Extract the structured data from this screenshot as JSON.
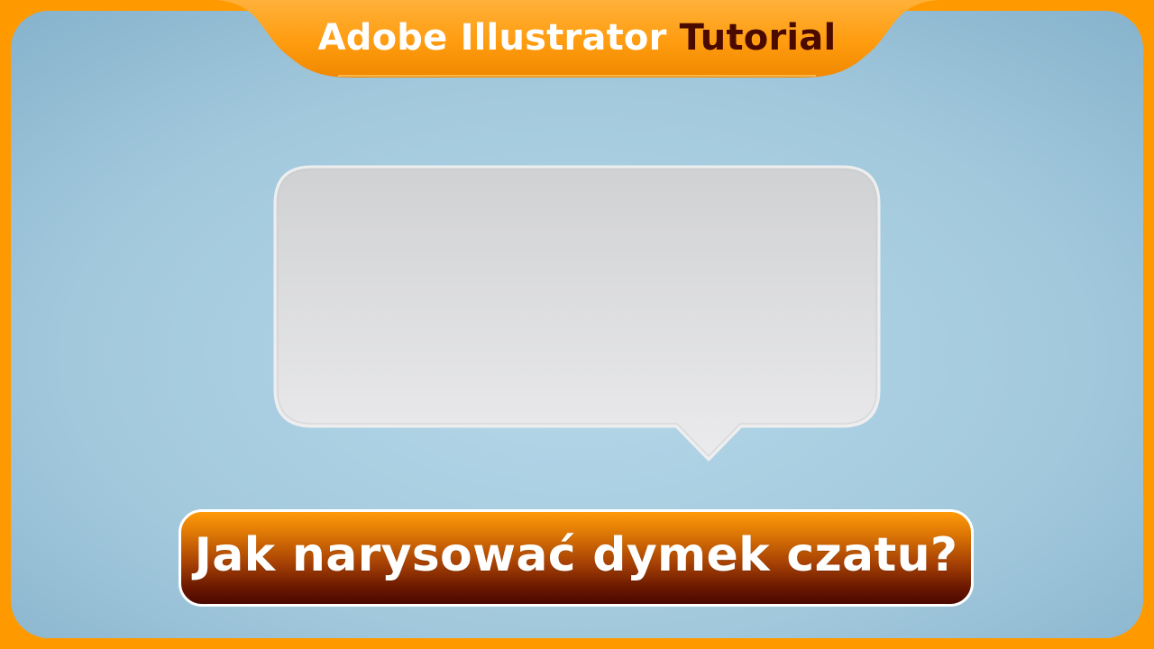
{
  "header": {
    "title_part_1": "Adobe Illustrator",
    "title_part_2": "Tutorial"
  },
  "caption": {
    "text": "Jak narysować dymek czatu?"
  },
  "colors": {
    "frame_orange": "#ff9900",
    "background_blue": "#a8cfe2",
    "title_dark": "#4a0a00",
    "bubble_fill": "#dcdde0",
    "caption_top": "#ff9a0a",
    "caption_bottom": "#4a0700"
  }
}
